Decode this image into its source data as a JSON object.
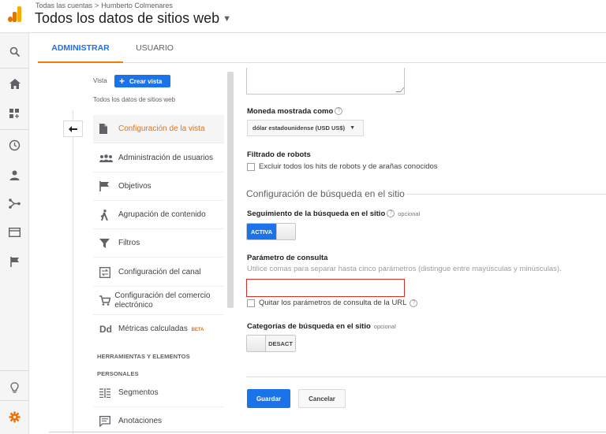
{
  "header": {
    "breadcrumb": [
      "Todas las cuentas",
      "Humberto Colmenares"
    ],
    "breadcrumb_separator": ">",
    "title": "Todos los datos de sitios web",
    "logo_colors": [
      "#f9ab00",
      "#e37400",
      "#e37400"
    ]
  },
  "rail": {
    "icons": [
      "search-icon",
      "home-icon",
      "dashboard-icon",
      "clock-icon",
      "person-icon",
      "acquisition-icon",
      "behavior-icon",
      "flag-icon",
      "lightbulb-icon",
      "gear-icon"
    ]
  },
  "tabs": [
    {
      "label": "ADMINISTRAR",
      "active": true
    },
    {
      "label": "USUARIO",
      "active": false
    }
  ],
  "view": {
    "label": "Vista",
    "create_button": "Crear vista",
    "name": "Todos los datos de sitios web"
  },
  "menu": [
    {
      "label": "Configuración de la vista",
      "icon": "document-icon",
      "active": true
    },
    {
      "label": "Administración de usuarios",
      "icon": "users-icon",
      "active": false
    },
    {
      "label": "Objetivos",
      "icon": "flag-icon",
      "active": false
    },
    {
      "label": "Agrupación de contenido",
      "icon": "walker-icon",
      "active": false
    },
    {
      "label": "Filtros",
      "icon": "filter-icon",
      "active": false
    },
    {
      "label": "Configuración del canal",
      "icon": "channel-icon",
      "active": false
    },
    {
      "label": "Configuración del comercio electrónico",
      "icon": "cart-icon",
      "active": false
    },
    {
      "label": "Métricas calculadas",
      "icon": "dd-icon",
      "icon_text": "Dd",
      "badge": "BETA",
      "active": false
    }
  ],
  "tools_section": {
    "heading_line1": "HERRAMIENTAS Y ELEMENTOS",
    "heading_line2": "PERSONALES",
    "items": [
      {
        "label": "Segmentos",
        "icon": "segments-icon"
      },
      {
        "label": "Anotaciones",
        "icon": "annotation-icon"
      }
    ]
  },
  "settings": {
    "currency_label": "Moneda mostrada como",
    "currency_value": "dólar estadounidense (USD US$)",
    "bot_filter_label": "Filtrado de robots",
    "bot_filter_checkbox": "Excluir todos los hits de robots y de arañas conocidos",
    "bot_filter_checked": false,
    "site_search_title": "Configuración de búsqueda en el sitio",
    "search_tracking_label": "Seguimiento de la búsqueda en el sitio",
    "search_tracking_optional": "opcional",
    "search_tracking_toggle": "ACTIVA",
    "search_tracking_on": true,
    "query_param_label": "Parámetro de consulta",
    "query_param_hint": "Utilice comas para separar hasta cinco parámetros (distingue entre mayúsculas y minúsculas).",
    "query_param_value": "",
    "strip_params_label": "Quitar los parámetros de consulta de la URL",
    "strip_params_checked": false,
    "categories_label": "Categorías de búsqueda en el sitio",
    "categories_optional": "opcional",
    "categories_toggle": "DESACT",
    "categories_on": false
  },
  "actions": {
    "save": "Guardar",
    "cancel": "Cancelar"
  },
  "colors": {
    "accent": "#1a73e8",
    "active_orange": "#e8710a",
    "tab_underline": "#f57c00",
    "error_border": "#d93025"
  }
}
